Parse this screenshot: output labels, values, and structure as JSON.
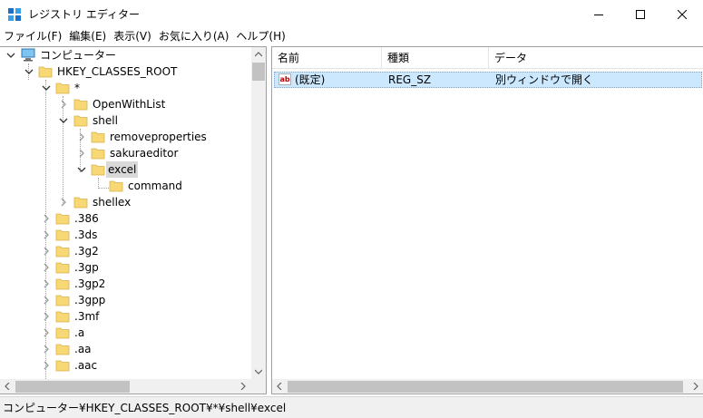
{
  "window": {
    "title": "レジストリ エディター"
  },
  "menu": [
    {
      "label": "ファイル(F)"
    },
    {
      "label": "編集(E)"
    },
    {
      "label": "表示(V)"
    },
    {
      "label": "お気に入り(A)"
    },
    {
      "label": "ヘルプ(H)"
    }
  ],
  "tree": {
    "computer": "コンピューター",
    "root": "HKEY_CLASSES_ROOT",
    "star": "*",
    "openwithlist": "OpenWithList",
    "shell": "shell",
    "removeproperties": "removeproperties",
    "sakuraeditor": "sakuraeditor",
    "excel": "excel",
    "command": "command",
    "shellex": "shellex",
    "extensions": [
      ".386",
      ".3ds",
      ".3g2",
      ".3gp",
      ".3gp2",
      ".3gpp",
      ".3mf",
      ".a",
      ".aa",
      ".aac"
    ]
  },
  "list": {
    "columns": {
      "name": "名前",
      "type": "種類",
      "data": "データ"
    },
    "rows": [
      {
        "icon": "ab",
        "name": "(既定)",
        "type": "REG_SZ",
        "data": "別ウィンドウで開く"
      }
    ]
  },
  "status": {
    "path": "コンピューター¥HKEY_CLASSES_ROOT¥*¥shell¥excel"
  },
  "icons": {
    "app": "registry-cubes-icon",
    "folder": "folder-icon",
    "computer": "computer-icon",
    "value": "string-value-icon"
  },
  "colors": {
    "folder": "#f8d775",
    "selection": "#cce8ff",
    "tree_selected": "#d9d9d9",
    "value_icon": "#c00000"
  }
}
